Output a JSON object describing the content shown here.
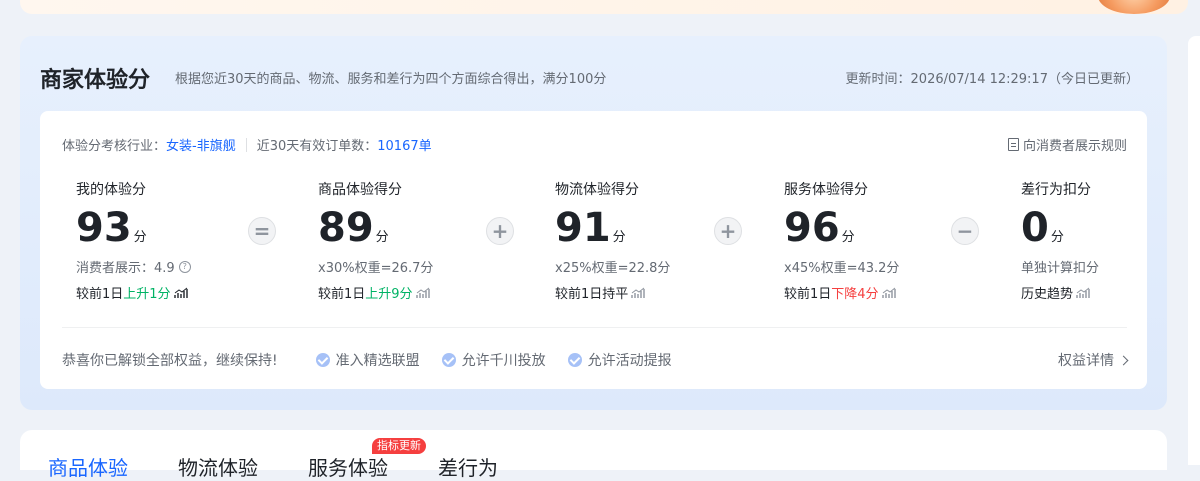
{
  "card": {
    "title": "商家体验分",
    "subtitle": "根据您近30天的商品、物流、服务和差行为四个方面综合得出，满分100分",
    "update_label": "更新时间：",
    "update_time": "2026/07/14 12:29:17",
    "update_note": "（今日已更新）"
  },
  "meta": {
    "industry_label": "体验分考核行业：",
    "industry_value": "女装-非旗舰",
    "orders_label": "近30天有效订单数：",
    "orders_value": "10167单",
    "rule_link": "向消费者展示规则"
  },
  "scores": {
    "mine": {
      "label": "我的体验分",
      "value": "93",
      "unit": "分",
      "line1": "消费者展示：4.9",
      "compare_prefix": "较前1日",
      "compare_value": "上升1分"
    },
    "product": {
      "label": "商品体验得分",
      "value": "89",
      "unit": "分",
      "line1": "x30%权重=26.7分",
      "compare_prefix": "较前1日",
      "compare_value": "上升9分"
    },
    "logistics": {
      "label": "物流体验得分",
      "value": "91",
      "unit": "分",
      "line1": "x25%权重=22.8分",
      "compare_prefix": "较前1日",
      "compare_value": "持平"
    },
    "service": {
      "label": "服务体验得分",
      "value": "96",
      "unit": "分",
      "line1": "x45%权重=43.2分",
      "compare_prefix": "较前1日",
      "compare_value": "下降4分"
    },
    "bad": {
      "label": "差行为扣分",
      "value": "0",
      "unit": "分",
      "line1": "单独计算扣分",
      "line2": "历史趋势"
    }
  },
  "operators": {
    "equals": "=",
    "plus": "+",
    "minus": "−"
  },
  "benefits": {
    "intro": "恭喜你已解锁全部权益，继续保持!",
    "items": [
      "准入精选联盟",
      "允许千川投放",
      "允许活动提报"
    ],
    "detail_link": "权益详情"
  },
  "tabs": {
    "items": [
      "商品体验",
      "物流体验",
      "服务体验",
      "差行为"
    ],
    "badge": "指标更新"
  },
  "colors": {
    "accent": "#1966ff",
    "up": "#00b365",
    "down": "#f53f3f"
  }
}
